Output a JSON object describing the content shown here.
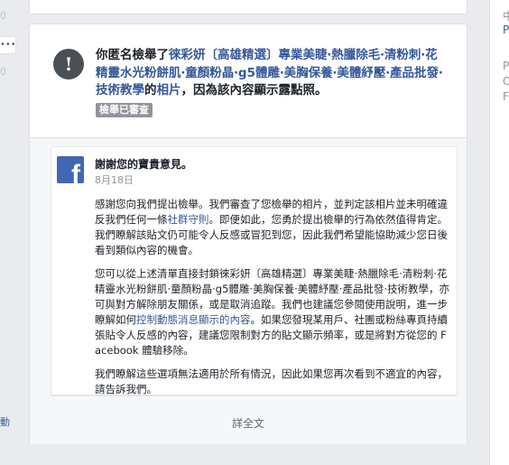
{
  "left": {
    "menu_dots": "•••",
    "count_top": "0",
    "count_bottom": "0",
    "action_label": "動"
  },
  "notice": {
    "text_before": "你匿名檢舉了",
    "page_name": "徠彩妍〔高雄精選〕專業美睫‧熱臘除毛‧清粉刺‧花精靈水光粉餅肌‧童顏粉晶‧g5體雕‧美胸保養‧美體紓壓‧產品批發‧技術教學",
    "text_possessive": "的",
    "photo_link": "相片",
    "text_after": "，因為該內容顯示露點照。",
    "badge": "檢舉已審查"
  },
  "message": {
    "title": "謝謝您的寶貴意見。",
    "date": "8月18日",
    "p1_before": "感謝您向我們提出檢舉。我們審查了您檢舉的相片，並判定該相片並未明確違反我們任何一條",
    "p1_link": "社群守則",
    "p1_after": "。即便如此，您勇於提出檢舉的行為依然值得肯定。我們瞭解該貼文仍可能令人反感或冒犯到您，因此我們希望能協助減少您日後看到類似內容的機會。",
    "p2_before": "您可以從上述清單直接封鎖徠彩妍〔高雄精選〕專業美睫‧熱臘除毛‧清粉刺‧花精靈水光粉餅肌‧童顏粉晶‧g5體雕‧美胸保養‧美體紓壓‧產品批發‧技術教學，亦可與對方解除朋友關係，或是取消追蹤。我們也建議您參閱使用說明，進一步瞭解如何",
    "p2_link": "控制動態消息顯示的內容",
    "p2_after": "。如果您發現某用戶、社團或粉絲專頁持續張貼令人反感的內容，建議您限制對方的貼文顯示頻率，或是將對方從您的 Facebook 體驗移除。",
    "p3": "我們瞭解這些選項無法適用於所有情況，因此如果您再次看到不適宜的內容，請告訴我們。",
    "view_full": "詳全文"
  },
  "right": {
    "items": [
      "中",
      "P",
      "P",
      "O",
      "F"
    ]
  },
  "colors": {
    "link": "#365899",
    "facebook_blue": "#4267b2",
    "badge_bg": "#90949c",
    "page_bg": "#e9ebee"
  },
  "icons": {
    "alert": "exclamation-circle-icon",
    "brand": "facebook-logo-icon"
  }
}
